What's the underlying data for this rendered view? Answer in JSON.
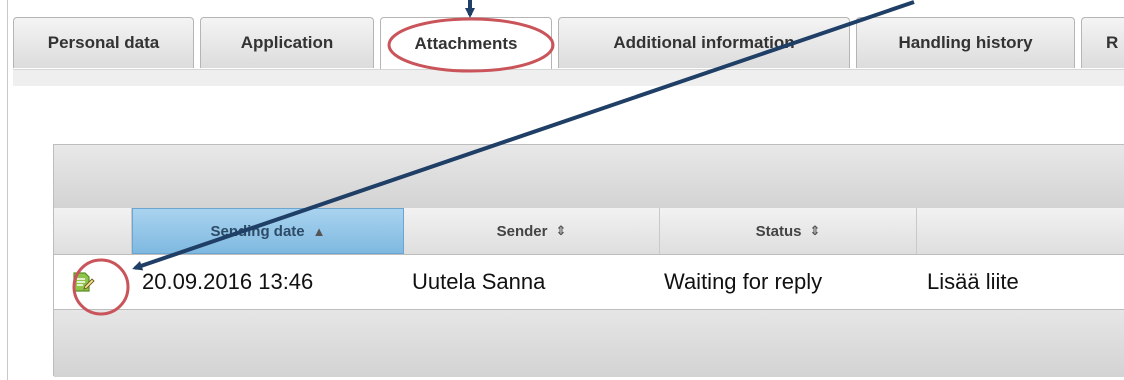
{
  "tabs": [
    {
      "label": "Personal data",
      "active": false
    },
    {
      "label": "Application",
      "active": false
    },
    {
      "label": "Attachments",
      "active": true
    },
    {
      "label": "Additional information",
      "active": false
    },
    {
      "label": "Handling history",
      "active": false
    },
    {
      "label": "R",
      "active": false
    }
  ],
  "table": {
    "columns": [
      {
        "label": "Sending date",
        "sort": "ascending"
      },
      {
        "label": "Sender",
        "sort": "none"
      },
      {
        "label": "Status",
        "sort": "none"
      },
      {
        "label": "",
        "sort": "none"
      }
    ],
    "sort_icons": {
      "ascending": "▲",
      "none": "⇕"
    },
    "rows": [
      {
        "icon": "edit-document-icon",
        "sending_date": "20.09.2016 13:46",
        "sender": "Uutela Sanna",
        "status": "Waiting for reply",
        "subject": "Lisää liite"
      }
    ]
  },
  "annotations": {
    "highlight_color": "#c9555a",
    "arrow_color": "#1f3f66"
  }
}
